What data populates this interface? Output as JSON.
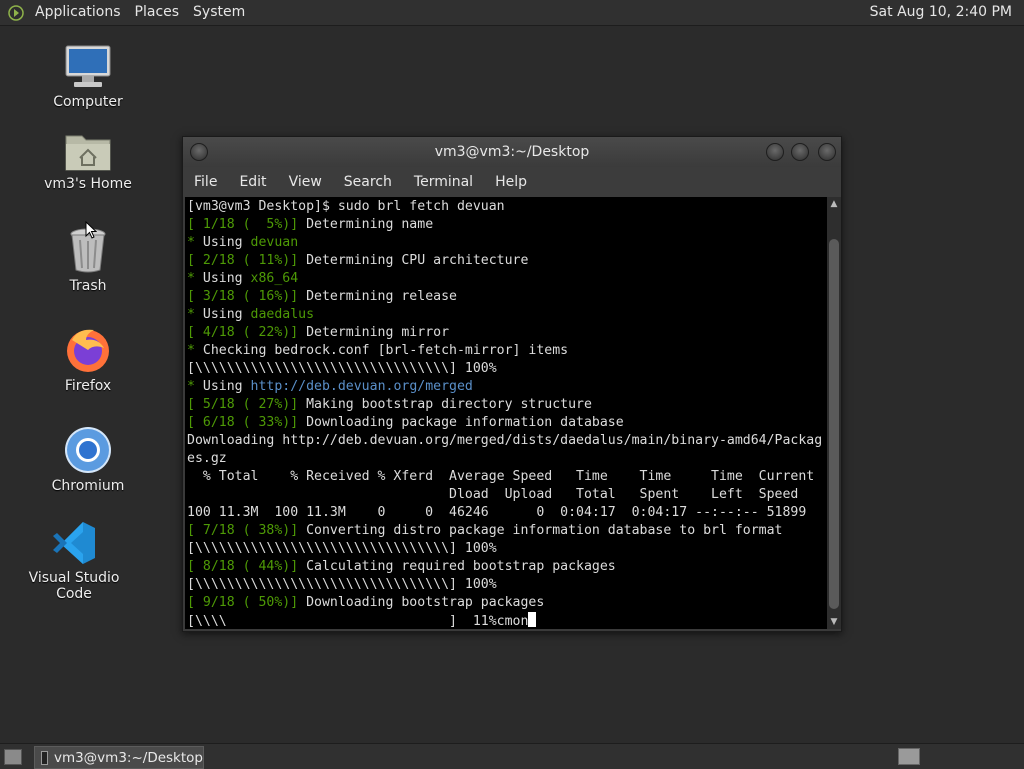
{
  "top_panel": {
    "menus": [
      "Applications",
      "Places",
      "System"
    ],
    "clock": "Sat Aug 10,  2:40 PM"
  },
  "desktop_icons": [
    {
      "label": "Computer",
      "icon": "computer-icon"
    },
    {
      "label": "vm3's Home",
      "icon": "home-folder-icon"
    },
    {
      "label": "Trash",
      "icon": "trash-icon"
    },
    {
      "label": "Firefox",
      "icon": "firefox-icon"
    },
    {
      "label": "Chromium",
      "icon": "chromium-icon"
    },
    {
      "label": "Visual Studio Code",
      "icon": "vscode-icon"
    }
  ],
  "terminal": {
    "title": "vm3@vm3:~/Desktop",
    "menu": [
      "File",
      "Edit",
      "View",
      "Search",
      "Terminal",
      "Help"
    ],
    "lines": [
      [
        {
          "t": "[vm3@vm3 Desktop]$ sudo brl fetch devuan",
          "c": ""
        }
      ],
      [
        {
          "t": "[ 1/18 (  5%)]",
          "c": "g"
        },
        {
          "t": " Determining name",
          "c": ""
        }
      ],
      [
        {
          "t": "*",
          "c": "g"
        },
        {
          "t": " Using ",
          "c": ""
        },
        {
          "t": "devuan",
          "c": "g"
        }
      ],
      [
        {
          "t": "[ 2/18 ( 11%)]",
          "c": "g"
        },
        {
          "t": " Determining CPU architecture",
          "c": ""
        }
      ],
      [
        {
          "t": "*",
          "c": "g"
        },
        {
          "t": " Using ",
          "c": ""
        },
        {
          "t": "x86_64",
          "c": "g"
        }
      ],
      [
        {
          "t": "[ 3/18 ( 16%)]",
          "c": "g"
        },
        {
          "t": " Determining release",
          "c": ""
        }
      ],
      [
        {
          "t": "*",
          "c": "g"
        },
        {
          "t": " Using ",
          "c": ""
        },
        {
          "t": "daedalus",
          "c": "g"
        }
      ],
      [
        {
          "t": "[ 4/18 ( 22%)]",
          "c": "g"
        },
        {
          "t": " Determining mirror",
          "c": ""
        }
      ],
      [
        {
          "t": "*",
          "c": "g"
        },
        {
          "t": " Checking bedrock.conf [brl-fetch-mirror] items",
          "c": ""
        }
      ],
      [
        {
          "t": "[\\\\\\\\\\\\\\\\\\\\\\\\\\\\\\\\\\\\\\\\\\\\\\\\\\\\\\\\\\\\\\\\] 100%",
          "c": ""
        }
      ],
      [
        {
          "t": "*",
          "c": "g"
        },
        {
          "t": " Using ",
          "c": ""
        },
        {
          "t": "http://deb.devuan.org/merged",
          "c": "b"
        }
      ],
      [
        {
          "t": "[ 5/18 ( 27%)]",
          "c": "g"
        },
        {
          "t": " Making bootstrap directory structure",
          "c": ""
        }
      ],
      [
        {
          "t": "[ 6/18 ( 33%)]",
          "c": "g"
        },
        {
          "t": " Downloading package information database",
          "c": ""
        }
      ],
      [
        {
          "t": "Downloading http://deb.devuan.org/merged/dists/daedalus/main/binary-amd64/Packag",
          "c": ""
        }
      ],
      [
        {
          "t": "es.gz",
          "c": ""
        }
      ],
      [
        {
          "t": "  % Total    % Received % Xferd  Average Speed   Time    Time     Time  Current",
          "c": ""
        }
      ],
      [
        {
          "t": "                                 Dload  Upload   Total   Spent    Left  Speed",
          "c": ""
        }
      ],
      [
        {
          "t": "100 11.3M  100 11.3M    0     0  46246      0  0:04:17  0:04:17 --:--:-- 51899",
          "c": ""
        }
      ],
      [
        {
          "t": "[ 7/18 ( 38%)]",
          "c": "g"
        },
        {
          "t": " Converting distro package information database to brl format",
          "c": ""
        }
      ],
      [
        {
          "t": "[\\\\\\\\\\\\\\\\\\\\\\\\\\\\\\\\\\\\\\\\\\\\\\\\\\\\\\\\\\\\\\\\] 100%",
          "c": ""
        }
      ],
      [
        {
          "t": "[ 8/18 ( 44%)]",
          "c": "g"
        },
        {
          "t": " Calculating required bootstrap packages",
          "c": ""
        }
      ],
      [
        {
          "t": "[\\\\\\\\\\\\\\\\\\\\\\\\\\\\\\\\\\\\\\\\\\\\\\\\\\\\\\\\\\\\\\\\] 100%",
          "c": ""
        }
      ],
      [
        {
          "t": "[ 9/18 ( 50%)]",
          "c": "g"
        },
        {
          "t": " Downloading bootstrap packages",
          "c": ""
        }
      ],
      [
        {
          "t": "[\\\\\\\\                            ]  11%cmon",
          "c": ""
        }
      ]
    ]
  },
  "taskbar": {
    "task_label": "vm3@vm3:~/Desktop"
  }
}
